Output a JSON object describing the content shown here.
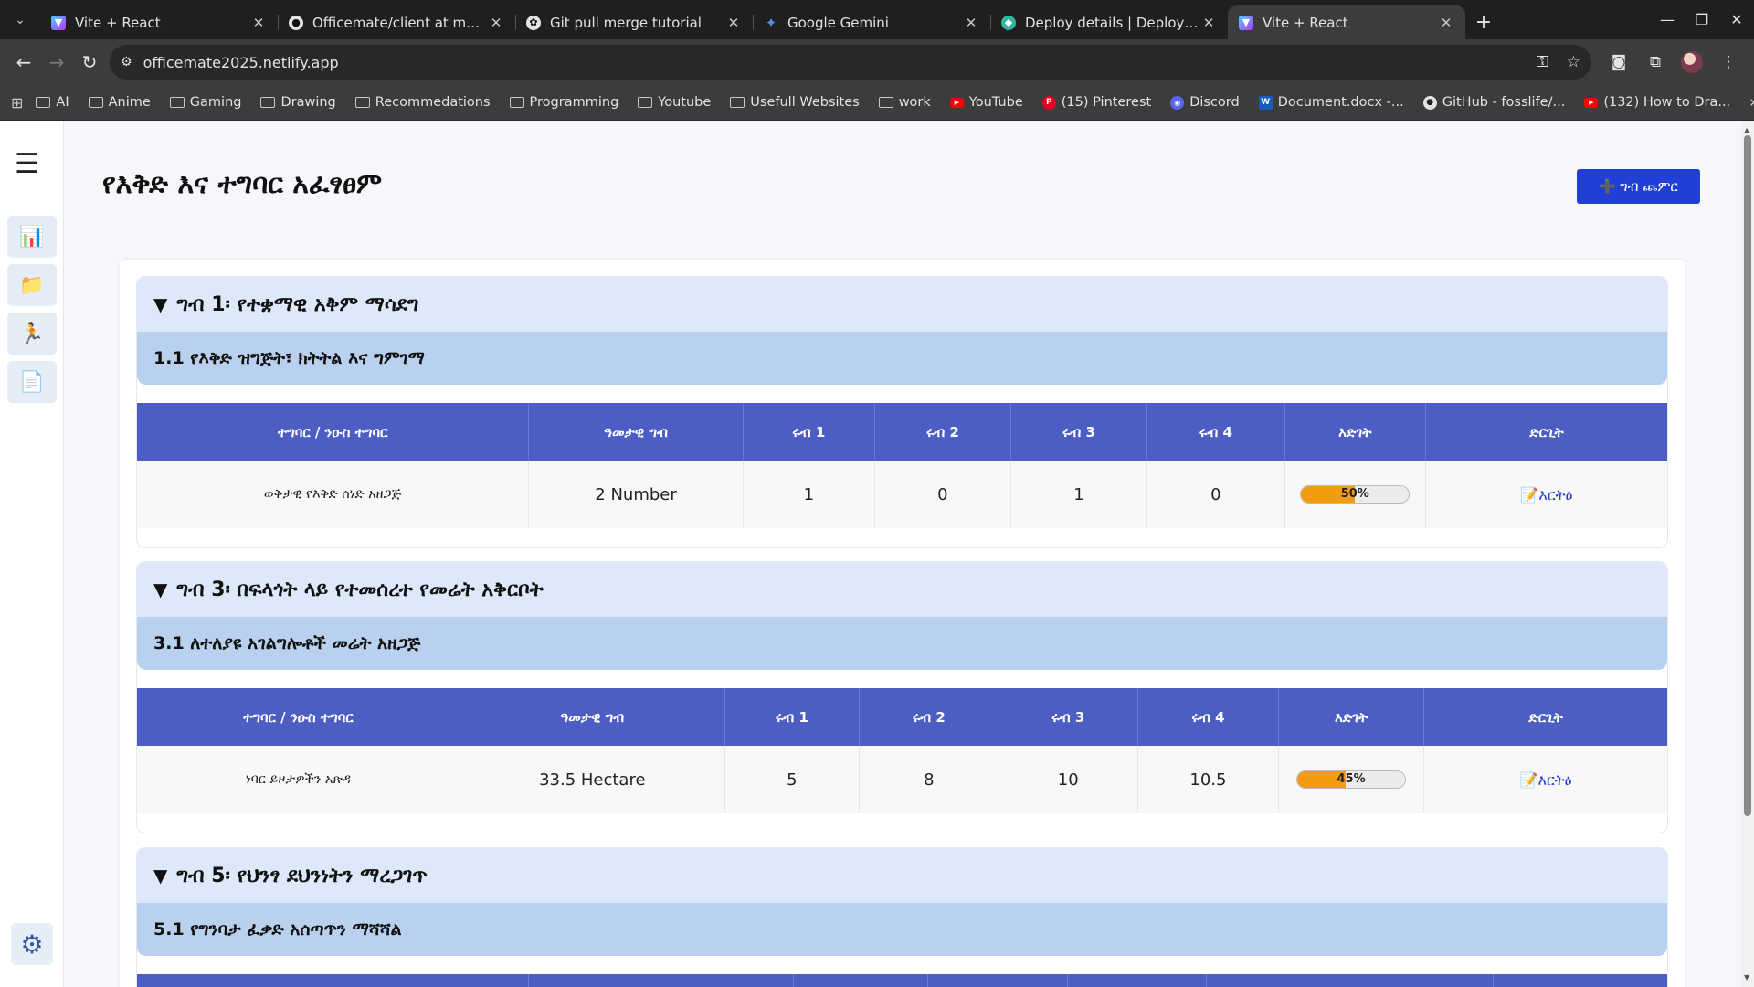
{
  "browser": {
    "tabs": [
      {
        "title": "Vite + React",
        "active": false
      },
      {
        "title": "Officemate/client at main · z",
        "active": false
      },
      {
        "title": "Git pull merge tutorial",
        "active": false
      },
      {
        "title": "Google Gemini",
        "active": false
      },
      {
        "title": "Deploy details | Deploys | off",
        "active": false
      },
      {
        "title": "Vite + React",
        "active": true
      }
    ],
    "url": "officemate2025.netlify.app",
    "bookmarks": [
      {
        "label": "AI",
        "icon": "folder-icon"
      },
      {
        "label": "Anime",
        "icon": "folder-icon"
      },
      {
        "label": "Gaming",
        "icon": "folder-icon"
      },
      {
        "label": "Drawing",
        "icon": "folder-icon"
      },
      {
        "label": "Recommedations",
        "icon": "folder-icon"
      },
      {
        "label": "Programming",
        "icon": "folder-icon"
      },
      {
        "label": "Youtube",
        "icon": "folder-icon"
      },
      {
        "label": "Usefull Websites",
        "icon": "folder-icon"
      },
      {
        "label": "work",
        "icon": "folder-icon"
      },
      {
        "label": "YouTube",
        "icon": "youtube-icon"
      },
      {
        "label": "(15) Pinterest",
        "icon": "pinterest-icon"
      },
      {
        "label": "Discord",
        "icon": "discord-icon"
      },
      {
        "label": "Document.docx -...",
        "icon": "word-icon"
      },
      {
        "label": "GitHub - fosslife/...",
        "icon": "github-icon"
      },
      {
        "label": "(132) How to Dra...",
        "icon": "youtube-icon"
      }
    ]
  },
  "page": {
    "title": "የእቅድ እና ተግባር አፈፃፀም",
    "add_button": "ግብ ጨምር"
  },
  "columns": [
    "ተግባር / ንዑስ ተግባር",
    "ዓመታዊ ግብ",
    "ሩብ 1",
    "ሩብ 2",
    "ሩብ 3",
    "ሩብ 4",
    "እድገት",
    "ድርጊት"
  ],
  "goals": [
    {
      "title": "ግብ 1፡ የተቋማዊ አቅም ማሳደግ",
      "subtitle": "1.1 የእቅድ ዝግጅት፣ ክትትል እና ግምገማ",
      "rows": [
        {
          "name": "ወቅታዊ የእቅድ ሰነድ አዘጋጅ",
          "target": "2 Number",
          "q1": "1",
          "q2": "0",
          "q3": "1",
          "q4": "0",
          "progress": 50,
          "progress_label": "50%",
          "action": "እርትዕ"
        }
      ]
    },
    {
      "title": "ግብ 3፡ በፍላጎት ላይ የተመሰረተ የመሬት አቅርቦት",
      "subtitle": "3.1 ለተለያዩ አገልግሎቶች መሬት አዘጋጅ",
      "rows": [
        {
          "name": "ነባር ይዞታዎችን አጽዳ",
          "target": "33.5 Hectare",
          "q1": "5",
          "q2": "8",
          "q3": "10",
          "q4": "10.5",
          "progress": 45,
          "progress_label": "45%",
          "action": "እርትዕ"
        }
      ]
    },
    {
      "title": "ግብ 5፡ የህንፃ ደህንነትን ማረጋገጥ",
      "subtitle": "5.1 የግንባታ ፈቃድ አሰጣጥን ማሻሻል",
      "rows": []
    }
  ],
  "colors": {
    "accent": "#1f3fd6",
    "table_header": "#4c5dc3",
    "goal_header": "#dde9fb",
    "sub_header": "#b9d1ef",
    "progress_fill": "#f39c12"
  }
}
